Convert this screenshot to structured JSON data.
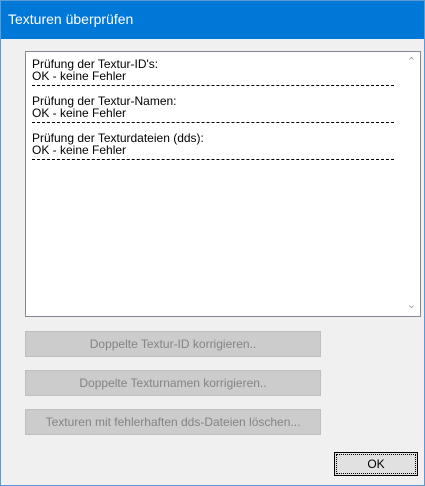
{
  "window": {
    "title": "Texturen überprüfen"
  },
  "report": {
    "sections": [
      {
        "heading": "Prüfung der Textur-ID's:",
        "result": "OK - keine Fehler"
      },
      {
        "heading": "Prüfung der Textur-Namen:",
        "result": "OK - keine Fehler"
      },
      {
        "heading": "Prüfung der Texturdateien (dds):",
        "result": "OK - keine Fehler"
      }
    ]
  },
  "scrollbar": {
    "up_icon": "chevron-up-icon",
    "down_icon": "chevron-down-icon",
    "up_glyph": "⌃",
    "down_glyph": "⌄"
  },
  "buttons": {
    "fix_duplicate_ids": "Doppelte Textur-ID korrigieren..",
    "fix_duplicate_names": "Doppelte Texturnamen korrigieren..",
    "delete_faulty_dds": "Texturen mit fehlerhaften dds-Dateien löschen...",
    "ok": "OK"
  },
  "colors": {
    "titlebar": "#0078d7",
    "window_bg": "#f0f0f0",
    "disabled_button_bg": "#cccccc",
    "disabled_text": "#838383"
  }
}
